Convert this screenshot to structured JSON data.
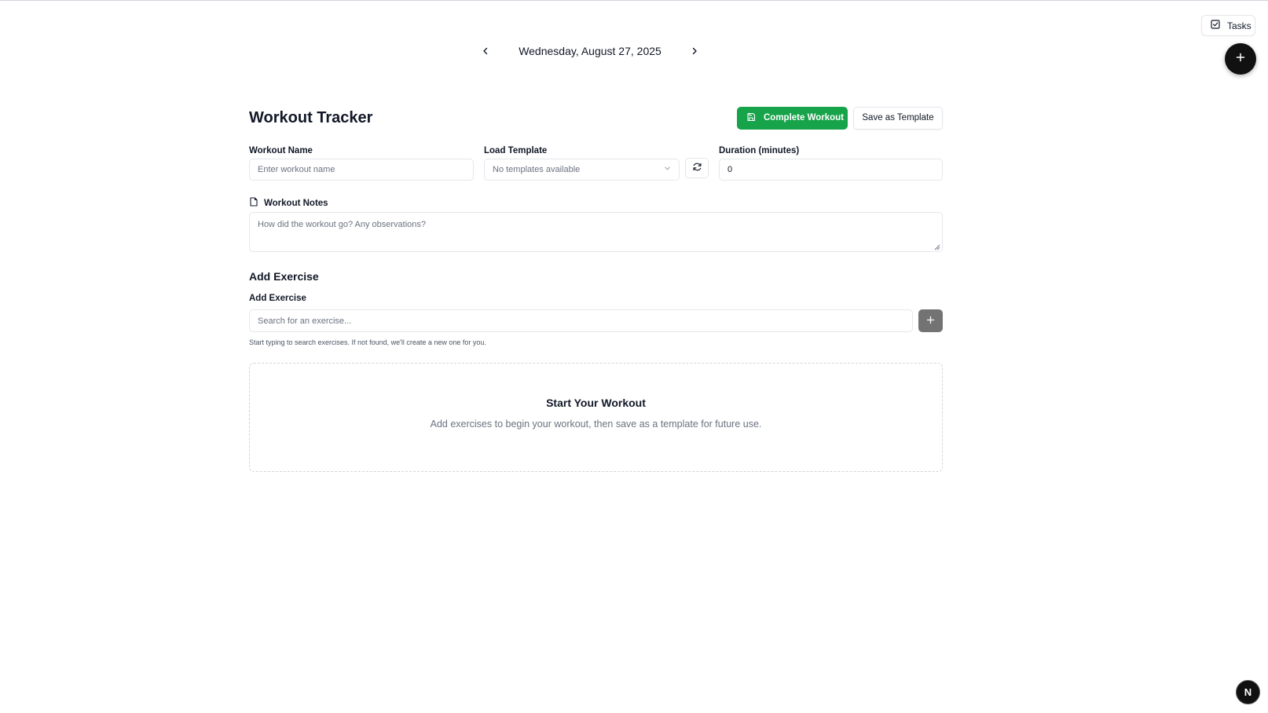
{
  "date_nav": {
    "prev_icon": "chevron-left-icon",
    "date": "Wednesday, August 27, 2025",
    "next_icon": "chevron-right-icon"
  },
  "top_right": {
    "tasks_label": "Tasks",
    "tasks_icon": "checkbox-icon",
    "fab_icon": "plus-icon"
  },
  "header": {
    "title": "Workout Tracker",
    "complete_label": "Complete Workout",
    "complete_icon": "save-icon",
    "template_label": "Save as Template"
  },
  "form": {
    "name_label": "Workout Name",
    "name_placeholder": "Enter workout name",
    "template_label": "Load Template",
    "template_value": "No templates available",
    "duration_label": "Duration (minutes)",
    "duration_value": "0",
    "notes_label": "Workout Notes",
    "notes_placeholder": "How did the workout go? Any observations?"
  },
  "add_exercise": {
    "section_title": "Add Exercise",
    "label": "Add Exercise",
    "search_placeholder": "Search for an exercise...",
    "hint": "Start typing to search exercises. If not found, we'll create a new one for you."
  },
  "empty_state": {
    "title": "Start Your Workout",
    "description": "Add exercises to begin your workout, then save as a template for future use."
  },
  "badge": {
    "letter": "N"
  },
  "colors": {
    "primary": "#16a34a",
    "dark": "#111111",
    "muted_button": "#737373"
  }
}
